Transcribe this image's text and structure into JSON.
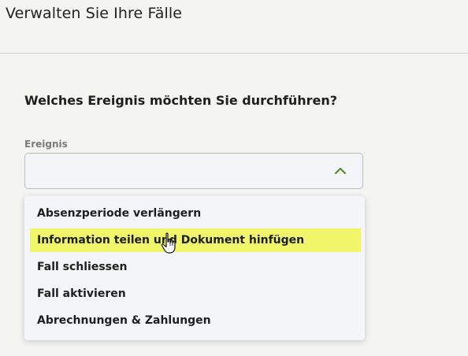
{
  "header": {
    "title": "Verwalten Sie Ihre Fälle"
  },
  "form": {
    "question": "Welches Ereignis möchten Sie durchführen?",
    "field_label": "Ereignis",
    "selected_value": "",
    "dropdown_state": "open",
    "chevron_icon": "chevron-up-icon",
    "accent_color": "#4a8c1c",
    "highlight_color": "#f0f56a"
  },
  "dropdown": {
    "options": [
      {
        "label": "Absenzperiode verlängern"
      },
      {
        "label": "Information teilen und Dokument hinfügen"
      },
      {
        "label": "Fall schliessen"
      },
      {
        "label": "Fall aktivieren"
      },
      {
        "label": "Abrechnungen & Zahlungen"
      }
    ],
    "hovered_option": "Information teilen und Dokument hinfügen"
  },
  "cursor_icon": "hand-pointer-icon"
}
